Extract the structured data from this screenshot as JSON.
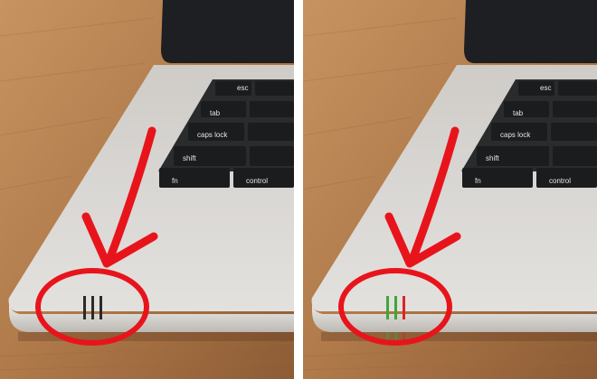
{
  "panels": [
    {
      "id": "left",
      "variant": "plain",
      "keys": {
        "esc": "esc",
        "tab": "tab",
        "caps": "caps lock",
        "shift": "shift",
        "fn": "fn",
        "control": "control"
      },
      "lights": [
        "#2a2a2a",
        "#2a2a2a",
        "#2a2a2a"
      ]
    },
    {
      "id": "right",
      "variant": "lit",
      "keys": {
        "esc": "esc",
        "tab": "tab",
        "caps": "caps lock",
        "shift": "shift",
        "fn": "fn",
        "control": "control"
      },
      "lights": [
        "#3fa63a",
        "#3fa63a",
        "#d92626"
      ]
    }
  ],
  "colors": {
    "desk": "#b07a4a",
    "laptop": "#d6d3cf",
    "laptop_edge": "#f2f1ee",
    "screen": "#1d1f22",
    "keycap": "#1b1c1e",
    "annotation": "#e8141c"
  }
}
